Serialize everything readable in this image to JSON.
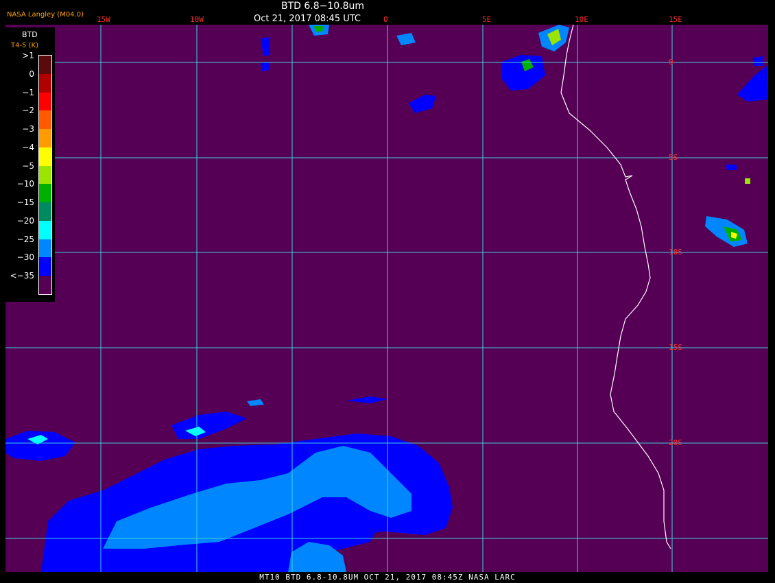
{
  "title": {
    "line1": "BTD 6.8−10.8um",
    "line2": "Oct 21, 2017 08:45 UTC"
  },
  "provider": "NASA Langley (M04.0)",
  "legend": {
    "title": "BTD",
    "subtitle": "T4-5 (K)",
    "ticks": [
      ">1",
      "0",
      "−1",
      "−2",
      "−3",
      "−4",
      "−5",
      "−10",
      "−15",
      "−20",
      "−25",
      "−30",
      "<−35"
    ],
    "colors": [
      "#5a0a0a",
      "#b00000",
      "#ff0000",
      "#ff5a00",
      "#ff9a00",
      "#ffff00",
      "#9be400",
      "#00b000",
      "#008a60",
      "#00ffff",
      "#0087ff",
      "#0000ff",
      "#550055"
    ]
  },
  "graticule": {
    "lon_labels": [
      "15W",
      "10W",
      "0",
      "5E",
      "10E",
      "15E"
    ],
    "lat_labels": [
      "0",
      "5S",
      "10S",
      "15S",
      "20S"
    ]
  },
  "footer": "MT10  BTD 6.8-10.8UM   OCT 21, 2017 08:45Z   NASA LARC",
  "colors": {
    "background": "#550055",
    "grid": "#40d0e0",
    "coast": "#ffffff",
    "label": "#ff3030",
    "cloud_blue": "#0000ff",
    "cloud_lightblue": "#0087ff",
    "cloud_cyan": "#00ffff",
    "cloud_green": "#00b000",
    "cloud_yellow": "#ffff00"
  }
}
